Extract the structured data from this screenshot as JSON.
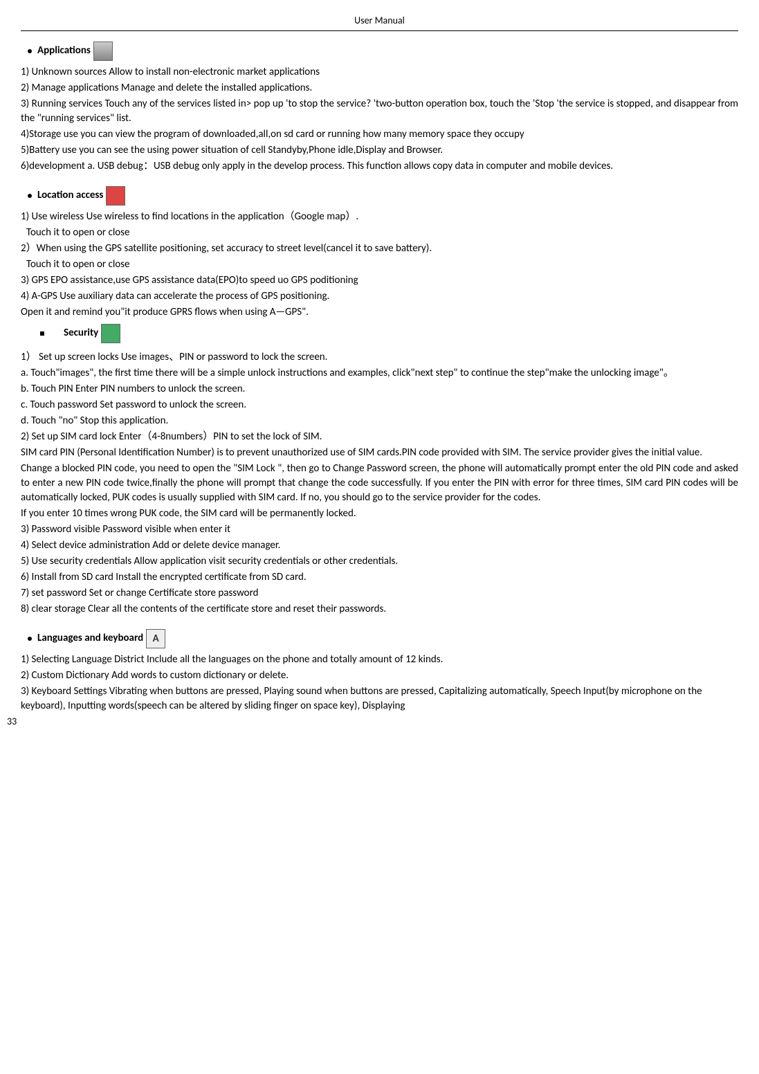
{
  "header": "User    Manual",
  "applications": {
    "title": "Applications",
    "item1": "1) Unknown sources              Allow to install non-electronic market applications",
    "item2": "2) Manage applications          Manage and delete the installed applications.",
    "item3": "3) Running services      Touch any of the services listed in> pop up 'to stop the service? 'two-button operation box, touch the 'Stop 'the service is stopped, and disappear from the \"running services\" list.",
    "item4": "4)Storage use          you can view the program of downloaded,all,on sd card or running    how many memory space they occupy",
    "item5": "5)Battery use           you can see the using power situation of cell Standyby,Phone idle,Display and Browser.",
    "item6": "6)development           a. USB debug：USB debug only apply in the develop process. This function allows copy data in computer and mobile devices."
  },
  "location": {
    "title": "Location    access",
    "item1": "1)  Use wireless    Use wireless to find locations in the application（Google map）.",
    "touch1": "Touch it to open or close",
    "item2": "2）When using the GPS satellite positioning, set accuracy to street level(cancel it to save battery).",
    "touch2": "Touch it to open or close",
    "item3": "3) GPS EPO assistance,use GPS assistance data(EPO)to speed uo GPS poditioning",
    "item4": "4) A-GPS      Use auxiliary data can accelerate the process of GPS positioning.",
    "item4b": "Open it and remind you\"it produce GPRS flows when using A—GPS\"."
  },
  "security": {
    "title": "Security",
    "item1": "1）  Set up screen locks      Use images、PIN or password to lock the screen.",
    "item1a": "a. Touch\"images\",    the first time there will be a simple unlock instructions and examples, click\"next step\" to continue the step\"make the unlocking image\"。",
    "item1b": "b. Touch PIN Enter PIN numbers to unlock the screen.",
    "item1c": "c. Touch password      Set password to unlock the screen.",
    "item1d": "d. Touch \"no\"      Stop this application.",
    "item2": "2)    Set up SIM card lock      Enter（4-8numbers）PIN to set the lock of SIM.",
    "item2p1": "SIM card PIN (Personal Identification Number) is to prevent unauthorized use of SIM cards.PIN code provided with SIM. The service provider gives the initial value.",
    "item2p2": "Change a blocked PIN code, you need to open the \"SIM Lock \", then go to Change Password screen, the phone will automatically prompt enter the old PIN code and asked to enter a new PIN code twice,finally the phone will prompt that change the code successfully. If you enter the PIN with error for three times, SIM card PIN codes will be automatically locked, PUK codes is usually supplied with SIM card. If no, you should go to the service provider for the codes.",
    "item2p3": "If you enter 10 times wrong PUK code, the SIM card will be permanently locked.",
    "item3": "3)    Password visible        Password visible when enter it",
    "item4": "4)    Select device administration       Add or delete device manager.",
    "item5": "5)    Use security credentials        Allow application visit security credentials or other credentials.",
    "item6": "6)    Install from SD card      Install the encrypted certificate from SD card.",
    "item7": "7)    set password         Set or change Certificate store password",
    "item8": "8)    clear storage         Clear all the contents of the certificate store and reset their passwords."
  },
  "languages": {
    "title": "Languages and keyboard",
    "item1": "1) Selecting Language District         Include all the languages on the phone and totally amount of 12 kinds.",
    "item2": "2) Custom Dictionary           Add words to custom dictionary or delete.",
    "item3": "3) Keyboard Settings         Vibrating when buttons are pressed, Playing sound when buttons are pressed, Capitalizing automatically, Speech Input(by microphone on the keyboard), Inputting words(speech can be altered by sliding finger on space key), Displaying"
  },
  "page_number": "33"
}
